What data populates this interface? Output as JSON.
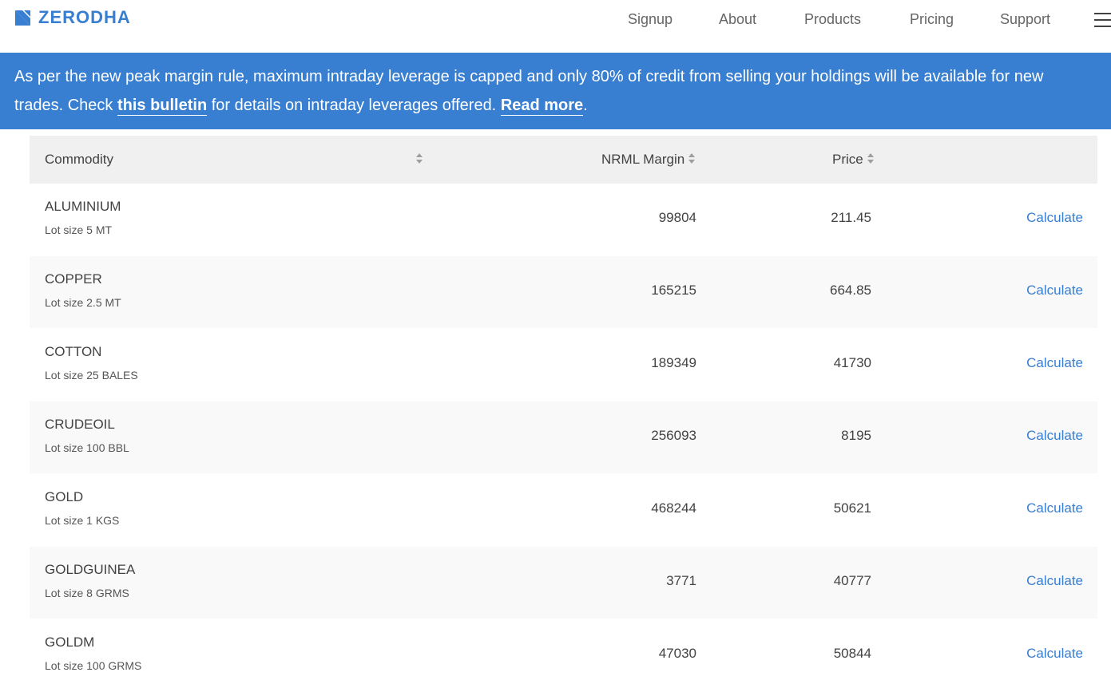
{
  "brand": {
    "name": "ZERODHA",
    "color": "#387ed1"
  },
  "nav": {
    "items": [
      "Signup",
      "About",
      "Products",
      "Pricing",
      "Support"
    ]
  },
  "banner": {
    "text_before": "As per the new peak margin rule, maximum intraday leverage is capped and only 80% of credit from selling your holdings will be available for new",
    "text_line2_start": "trades. Check ",
    "link1": "this bulletin",
    "text_middle": " for details on intraday leverages offered. ",
    "link2": "Read more",
    "text_end": ".",
    "background": "#387ed1"
  },
  "table": {
    "headers": {
      "commodity": "Commodity",
      "margin": "NRML Margin",
      "price": "Price"
    },
    "action_label": "Calculate",
    "rows": [
      {
        "name": "ALUMINIUM",
        "lot": "Lot size 5 MT",
        "margin": "99804",
        "price": "211.45"
      },
      {
        "name": "COPPER",
        "lot": "Lot size 2.5 MT",
        "margin": "165215",
        "price": "664.85"
      },
      {
        "name": "COTTON",
        "lot": "Lot size 25 BALES",
        "margin": "189349",
        "price": "41730"
      },
      {
        "name": "CRUDEOIL",
        "lot": "Lot size 100 BBL",
        "margin": "256093",
        "price": "8195"
      },
      {
        "name": "GOLD",
        "lot": "Lot size 1 KGS",
        "margin": "468244",
        "price": "50621"
      },
      {
        "name": "GOLDGUINEA",
        "lot": "Lot size 8 GRMS",
        "margin": "3771",
        "price": "40777"
      },
      {
        "name": "GOLDM",
        "lot": "Lot size 100 GRMS",
        "margin": "47030",
        "price": "50844"
      }
    ]
  }
}
